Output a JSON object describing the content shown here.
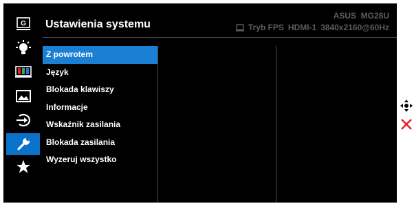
{
  "header": {
    "title": "Ustawienia systemu",
    "model": "ASUS  MG28U",
    "mode": "Tryb FPS",
    "input": "HDMI-1",
    "resolution": "3840x2160@60Hz"
  },
  "sidebar": {
    "icons": [
      "gameplus-icon",
      "brightness-icon",
      "color-icon",
      "image-icon",
      "input-select-icon",
      "system-setup-icon",
      "myfavorite-icon"
    ],
    "active_index": 5
  },
  "menu": {
    "selected_index": 0,
    "items": [
      {
        "label": "Z powrotem"
      },
      {
        "label": "Język"
      },
      {
        "label": "Blokada klawiszy"
      },
      {
        "label": "Informacje"
      },
      {
        "label": "Wskaźnik zasilania"
      },
      {
        "label": "Blokada zasilania"
      },
      {
        "label": "Wyzeruj wszystko"
      }
    ]
  },
  "hints": {
    "navigate_icon": "five-way-joystick-icon",
    "exit_icon": "close-icon"
  },
  "colors": {
    "background": "#000000",
    "accent": "#1b7fd3",
    "muted_text": "#5d5d5d",
    "exit_red": "#e8202a"
  }
}
